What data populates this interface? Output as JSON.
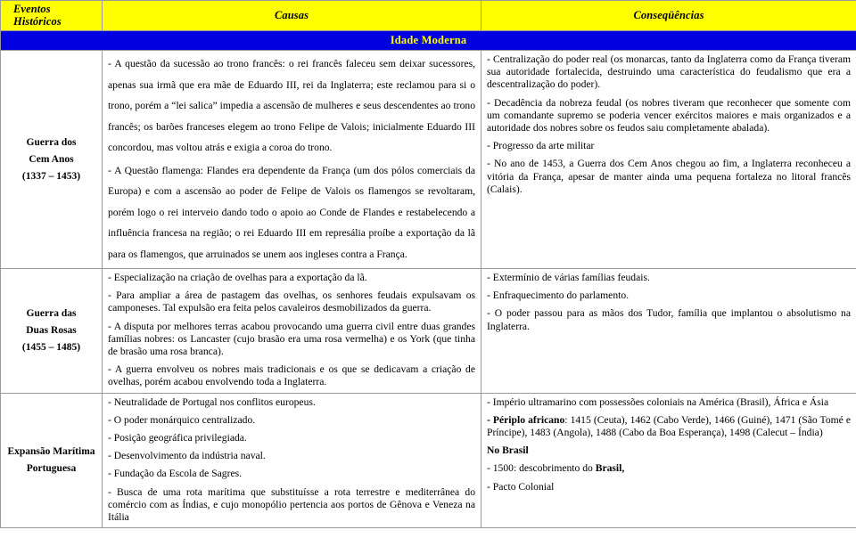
{
  "header": {
    "col_eventos": "Eventos Históricos",
    "col_causas": "Causas",
    "col_conseq": "Conseqüências"
  },
  "banner": {
    "title": "Idade Moderna"
  },
  "rows": [
    {
      "event": {
        "line1": "Guerra dos",
        "line2": "Cem Anos",
        "line3": "(1337 – 1453)"
      },
      "causas": [
        "- A questão da sucessão ao trono francês: o rei francês faleceu sem deixar sucessores, apenas sua irmã que era mãe de Eduardo III, rei da Inglaterra; este reclamou para si o trono, porém a “lei salica” impedia a ascensão de mulheres e seus descendentes ao trono francês; os barões franceses elegem ao trono Felipe de Valois; inicialmente Eduardo III concordou, mas voltou atrás e exigia a coroa do trono.",
        "- A Questão flamenga: Flandes era dependente da França (um dos pólos comerciais da Europa) e com a ascensão ao poder de Felipe de Valois os flamengos se revoltaram, porém logo o rei interveio dando todo o apoio ao Conde de Flandes e restabelecendo a influência francesa na região; o rei Eduardo III em represália proíbe a exportação da lã para os flamengos, que arruinados se unem aos ingleses contra a França."
      ],
      "conseq": [
        "- Centralização do poder real (os monarcas, tanto da Inglaterra como da França tiveram sua autoridade fortalecida, destruindo uma característica do feudalismo que era a descentralização do poder).",
        "- Decadência da nobreza feudal (os nobres tiveram que reconhecer que somente com um comandante supremo se poderia vencer exércitos maiores e mais organizados e a autoridade dos nobres sobre os feudos saiu completamente abalada).",
        "- Progresso da arte militar",
        "- No ano de 1453, a Guerra dos Cem Anos chegou ao fim, a Inglaterra reconheceu a vitória da França, apesar de manter ainda uma pequena fortaleza no litoral francês (Calais)."
      ]
    },
    {
      "event": {
        "line1": "Guerra das",
        "line2": "Duas Rosas",
        "line3": "(1455 – 1485)"
      },
      "causas": [
        "- Especialização na criação de ovelhas para a exportação da lã.",
        "- Para ampliar a área de pastagem das ovelhas, os senhores feudais expulsavam os camponeses. Tal expulsão era feita pelos cavaleiros desmobilizados da guerra.",
        "- A disputa por melhores terras acabou provocando uma guerra civil entre duas grandes famílias nobres: os Lancaster (cujo brasão era uma rosa vermelha) e os York (que tinha de brasão uma rosa branca).",
        "- A guerra envolveu os nobres mais tradicionais e os que se dedicavam a criação de ovelhas, porém acabou envolvendo toda a Inglaterra."
      ],
      "conseq": [
        "- Extermínio de várias famílias feudais.",
        "- Enfraquecimento do parlamento.",
        "- O poder passou para as mãos dos Tudor, família que implantou o absolutismo na Inglaterra."
      ]
    },
    {
      "event": {
        "line1": "Expansão Marítima",
        "line2": "Portuguesa",
        "line3": ""
      },
      "causas": [
        "- Neutralidade de Portugal nos conflitos europeus.",
        "- O poder monárquico centralizado.",
        "- Posição geográfica privilegiada.",
        "- Desenvolvimento da indústria naval.",
        "- Fundação da Escola de Sagres.",
        "- Busca de uma rota marítima que substituísse a rota terrestre e mediterrânea do comércio com as Índias, e cujo monopólio pertencia aos portos de Gênova e Veneza na Itália"
      ],
      "conseq_rich": [
        {
          "text": "- Império ultramarino com possessões coloniais na América (Brasil), África e Ásia",
          "bold_prefix": ""
        },
        {
          "bold_prefix": "- Périplo africano",
          "text": ": 1415 (Ceuta), 1462 (Cabo Verde), 1466 (Guiné), 1471 (São Tomé e Príncipe), 1483 (Angola), 1488 (Cabo da Boa Esperança), 1498 (Calecut – Índia)"
        },
        {
          "bold_all": "No Brasil"
        },
        {
          "text": "- 1500: descobrimento do ",
          "bold_suffix": "Brasil,"
        },
        {
          "text": "- Pacto Colonial"
        }
      ]
    }
  ],
  "colors": {
    "header_bg": "#ffff00",
    "banner_bg": "#0000e0",
    "banner_text": "#ffff00",
    "border": "#9a9a9a",
    "text": "#000000"
  }
}
